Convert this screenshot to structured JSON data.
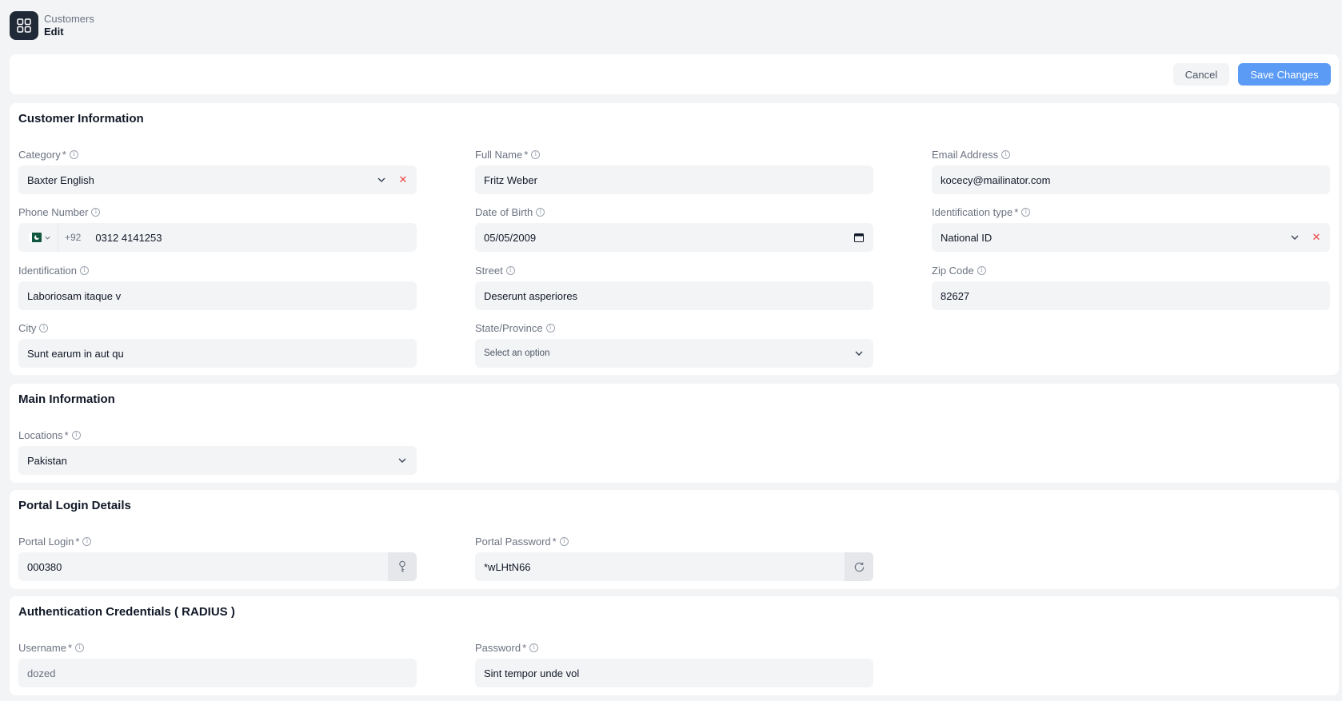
{
  "breadcrumb": {
    "parent": "Customers",
    "current": "Edit"
  },
  "actions": {
    "cancel_label": "Cancel",
    "save_label": "Save Changes"
  },
  "sections": {
    "customer_info": "Customer Information",
    "main_info": "Main Information",
    "portal_login": "Portal Login Details",
    "auth_credentials": "Authentication Credentials ( RADIUS )"
  },
  "fields": {
    "category": {
      "label": "Category",
      "value": "Baxter English"
    },
    "full_name": {
      "label": "Full Name",
      "value": "Fritz Weber"
    },
    "email": {
      "label": "Email Address",
      "value": "kocecy@mailinator.com"
    },
    "phone": {
      "label": "Phone Number",
      "dial_code": "+92",
      "value": "0312 4141253"
    },
    "dob": {
      "label": "Date of Birth",
      "value": "05/05/2009"
    },
    "id_type": {
      "label": "Identification type",
      "value": "National ID"
    },
    "identification": {
      "label": "Identification",
      "value": "Laboriosam itaque v"
    },
    "street": {
      "label": "Street",
      "value": "Deserunt asperiores"
    },
    "zip": {
      "label": "Zip Code",
      "value": "82627"
    },
    "city": {
      "label": "City",
      "value": "Sunt earum in aut qu"
    },
    "state": {
      "label": "State/Province",
      "placeholder": "Select an option"
    },
    "locations": {
      "label": "Locations",
      "value": "Pakistan"
    },
    "portal_login": {
      "label": "Portal Login",
      "value": "000380"
    },
    "portal_password": {
      "label": "Portal Password",
      "value": "*wLHtN66"
    },
    "username": {
      "label": "Username",
      "value": "dozed"
    },
    "password": {
      "label": "Password",
      "value": "Sint tempor unde vol"
    }
  },
  "symbols": {
    "required": "*",
    "info": "i",
    "clear": "✕"
  },
  "icons": {
    "app": "grid-icon",
    "dropdown": "chevron-down-icon",
    "clear": "close-icon",
    "calendar": "calendar-icon",
    "info": "info-icon",
    "key": "key-icon",
    "regenerate": "refresh-icon"
  },
  "colors": {
    "primary": "#5b9bf5",
    "clear": "#ef4444",
    "app_icon_bg": "#1f2937"
  }
}
